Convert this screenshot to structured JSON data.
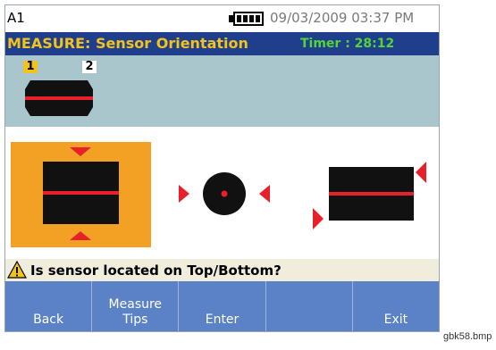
{
  "status": {
    "channel": "A1",
    "datetime": "09/03/2009 03:37 PM",
    "battery_icon": "battery-full-icon"
  },
  "header": {
    "title": "MEASURE: Sensor Orientation",
    "timer": "Timer : 28:12"
  },
  "sensor_panel": {
    "tag_1": "1",
    "tag_2": "2"
  },
  "orientation_options": [
    {
      "name": "top-bottom",
      "selected": true
    },
    {
      "name": "side",
      "selected": false
    },
    {
      "name": "rear",
      "selected": false
    }
  ],
  "prompt": {
    "icon": "warning-icon",
    "text": "Is sensor located on Top/Bottom?"
  },
  "softkeys": [
    {
      "label": "Back"
    },
    {
      "label": "Measure\nTips"
    },
    {
      "label": "Enter"
    },
    {
      "label": ""
    },
    {
      "label": "Exit"
    }
  ],
  "caption": "gbk58.bmp",
  "colors": {
    "title_bar": "#1f3f8c",
    "title_text": "#f2c21d",
    "timer_text": "#54d43a",
    "selection": "#f2a124",
    "softkey_bar": "#5b82c6",
    "marker_red": "#e8202a"
  }
}
